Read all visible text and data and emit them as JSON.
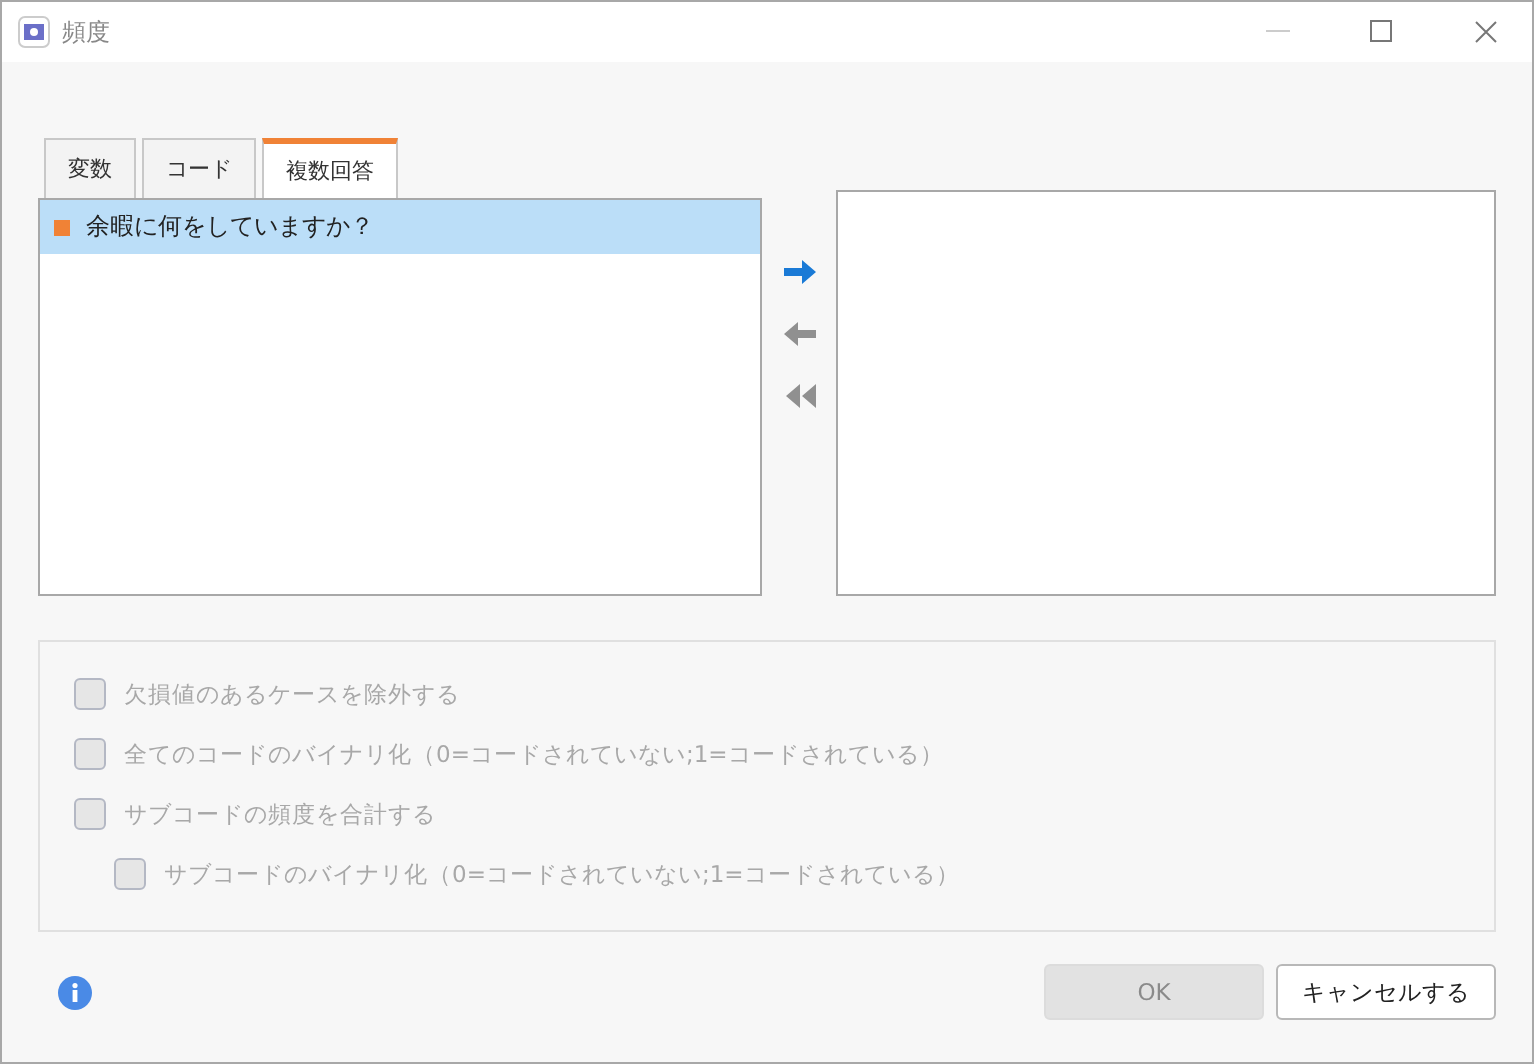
{
  "window": {
    "title": "頻度"
  },
  "tabs": [
    {
      "label": "変数",
      "selected": false
    },
    {
      "label": "コード",
      "selected": false
    },
    {
      "label": "複数回答",
      "selected": true
    }
  ],
  "source_list": [
    {
      "label": "余暇に何をしていますか？",
      "selected": true,
      "color": "#f08236"
    }
  ],
  "arrows": [
    {
      "kind": "right",
      "disabled": false
    },
    {
      "kind": "left",
      "disabled": true
    },
    {
      "kind": "all-left",
      "disabled": true
    }
  ],
  "options": [
    {
      "label": "欠損値のあるケースを除外する",
      "checked": false,
      "disabled": true
    },
    {
      "label": "全てのコードのバイナリ化（0=コードされていない;1=コードされている）",
      "checked": false,
      "disabled": true
    },
    {
      "label": "サブコードの頻度を合計する",
      "checked": false,
      "disabled": true,
      "children": [
        {
          "label": "サブコードのバイナリ化（0=コードされていない;1=コードされている）",
          "checked": false,
          "disabled": true
        }
      ]
    }
  ],
  "buttons": [
    {
      "label": "OK",
      "disabled": true
    },
    {
      "label": "キャンセルする",
      "disabled": false
    }
  ]
}
